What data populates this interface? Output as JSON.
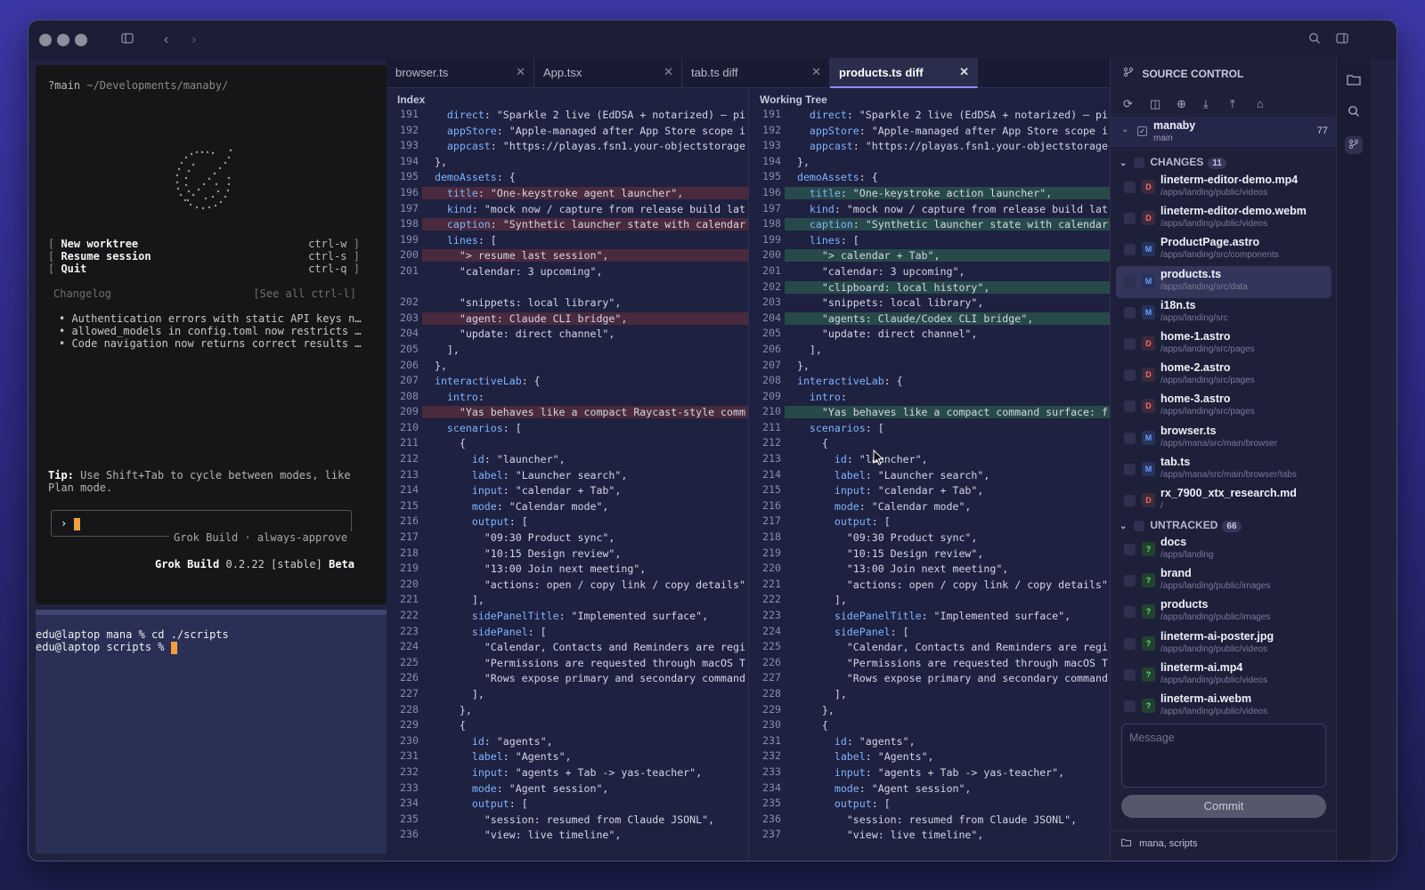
{
  "terminal": {
    "path_prefix": "?main",
    "path": "~/Developments/manaby/",
    "menu": [
      {
        "label": "New worktree",
        "key": "ctrl-w"
      },
      {
        "label": "Resume session",
        "key": "ctrl-s"
      },
      {
        "label": "Quit",
        "key": "ctrl-q"
      }
    ],
    "changelog_title": "Changelog",
    "changelog_link": "[See all ctrl-l]",
    "changelog": [
      "Authentication errors with static API keys now…",
      "allowed_models in config.toml now restricts wh…",
      "Code navigation now returns correct results fo…"
    ],
    "tip_label": "Tip:",
    "tip_text": "Use Shift+Tab to cycle between modes, like Plan mode.",
    "prompt_glyph": "›",
    "prompt_hint": "Grok Build · always-approve",
    "app_name": "Grok Build",
    "version": "0.2.22 [stable]",
    "channel": "Beta"
  },
  "shell": {
    "lines": [
      "edu@laptop mana % cd ./scripts",
      "edu@laptop scripts % "
    ]
  },
  "tabs": [
    {
      "label": "browser.ts",
      "active": false
    },
    {
      "label": "App.tsx",
      "active": false
    },
    {
      "label": "tab.ts diff",
      "active": false
    },
    {
      "label": "products.ts diff",
      "active": true
    }
  ],
  "diff": {
    "left_title": "Index",
    "right_title": "Working Tree",
    "left": [
      {
        "n": "191",
        "c": "    direct: \"Sparkle 2 live (EdDSA + notarized) — pi",
        "t": ""
      },
      {
        "n": "192",
        "c": "    appStore: \"Apple-managed after App Store scope i",
        "t": ""
      },
      {
        "n": "193",
        "c": "    appcast: \"https://playas.fsn1.your-objectstorage",
        "t": ""
      },
      {
        "n": "194",
        "c": "  },",
        "t": ""
      },
      {
        "n": "195",
        "c": "  demoAssets: {",
        "t": ""
      },
      {
        "n": "196",
        "c": "    title: \"One-keystroke agent launcher\",",
        "t": "del"
      },
      {
        "n": "197",
        "c": "    kind: \"mock now / capture from release build lat",
        "t": ""
      },
      {
        "n": "198",
        "c": "    caption: \"Synthetic launcher state with calendar",
        "t": "del"
      },
      {
        "n": "199",
        "c": "    lines: [",
        "t": ""
      },
      {
        "n": "200",
        "c": "      \"> resume last session\",",
        "t": "del"
      },
      {
        "n": "201",
        "c": "      \"calendar: 3 upcoming\",",
        "t": ""
      },
      {
        "n": "",
        "c": "",
        "t": "blank"
      },
      {
        "n": "202",
        "c": "      \"snippets: local library\",",
        "t": ""
      },
      {
        "n": "203",
        "c": "      \"agent: Claude CLI bridge\",",
        "t": "del"
      },
      {
        "n": "204",
        "c": "      \"update: direct channel\",",
        "t": ""
      },
      {
        "n": "205",
        "c": "    ],",
        "t": ""
      },
      {
        "n": "206",
        "c": "  },",
        "t": ""
      },
      {
        "n": "207",
        "c": "  interactiveLab: {",
        "t": ""
      },
      {
        "n": "208",
        "c": "    intro:",
        "t": ""
      },
      {
        "n": "209",
        "c": "      \"Yas behaves like a compact Raycast-style comm",
        "t": "del"
      },
      {
        "n": "210",
        "c": "    scenarios: [",
        "t": ""
      },
      {
        "n": "211",
        "c": "      {",
        "t": ""
      },
      {
        "n": "212",
        "c": "        id: \"launcher\",",
        "t": ""
      },
      {
        "n": "213",
        "c": "        label: \"Launcher search\",",
        "t": ""
      },
      {
        "n": "214",
        "c": "        input: \"calendar + Tab\",",
        "t": ""
      },
      {
        "n": "215",
        "c": "        mode: \"Calendar mode\",",
        "t": ""
      },
      {
        "n": "216",
        "c": "        output: [",
        "t": ""
      },
      {
        "n": "217",
        "c": "          \"09:30 Product sync\",",
        "t": ""
      },
      {
        "n": "218",
        "c": "          \"10:15 Design review\",",
        "t": ""
      },
      {
        "n": "219",
        "c": "          \"13:00 Join next meeting\",",
        "t": ""
      },
      {
        "n": "220",
        "c": "          \"actions: open / copy link / copy details\"",
        "t": ""
      },
      {
        "n": "221",
        "c": "        ],",
        "t": ""
      },
      {
        "n": "222",
        "c": "        sidePanelTitle: \"Implemented surface\",",
        "t": ""
      },
      {
        "n": "223",
        "c": "        sidePanel: [",
        "t": ""
      },
      {
        "n": "224",
        "c": "          \"Calendar, Contacts and Reminders are regi",
        "t": ""
      },
      {
        "n": "225",
        "c": "          \"Permissions are requested through macOS T",
        "t": ""
      },
      {
        "n": "226",
        "c": "          \"Rows expose primary and secondary command",
        "t": ""
      },
      {
        "n": "227",
        "c": "        ],",
        "t": ""
      },
      {
        "n": "228",
        "c": "      },",
        "t": ""
      },
      {
        "n": "229",
        "c": "      {",
        "t": ""
      },
      {
        "n": "230",
        "c": "        id: \"agents\",",
        "t": ""
      },
      {
        "n": "231",
        "c": "        label: \"Agents\",",
        "t": ""
      },
      {
        "n": "232",
        "c": "        input: \"agents + Tab -> yas-teacher\",",
        "t": ""
      },
      {
        "n": "233",
        "c": "        mode: \"Agent session\",",
        "t": ""
      },
      {
        "n": "234",
        "c": "        output: [",
        "t": ""
      },
      {
        "n": "235",
        "c": "          \"session: resumed from Claude JSONL\",",
        "t": ""
      },
      {
        "n": "236",
        "c": "          \"view: live timeline\",",
        "t": ""
      }
    ],
    "right": [
      {
        "n": "191",
        "c": "    direct: \"Sparkle 2 live (EdDSA + notarized) — pi",
        "t": ""
      },
      {
        "n": "192",
        "c": "    appStore: \"Apple-managed after App Store scope i",
        "t": ""
      },
      {
        "n": "193",
        "c": "    appcast: \"https://playas.fsn1.your-objectstorage",
        "t": ""
      },
      {
        "n": "194",
        "c": "  },",
        "t": ""
      },
      {
        "n": "195",
        "c": "  demoAssets: {",
        "t": ""
      },
      {
        "n": "196",
        "c": "    title: \"One-keystroke action launcher\",",
        "t": "add"
      },
      {
        "n": "197",
        "c": "    kind: \"mock now / capture from release build lat",
        "t": ""
      },
      {
        "n": "198",
        "c": "    caption: \"Synthetic launcher state with calendar",
        "t": "add"
      },
      {
        "n": "199",
        "c": "    lines: [",
        "t": ""
      },
      {
        "n": "200",
        "c": "      \"> calendar + Tab\",",
        "t": "add"
      },
      {
        "n": "201",
        "c": "      \"calendar: 3 upcoming\",",
        "t": ""
      },
      {
        "n": "202",
        "c": "      \"clipboard: local history\",",
        "t": "add"
      },
      {
        "n": "203",
        "c": "      \"snippets: local library\",",
        "t": ""
      },
      {
        "n": "204",
        "c": "      \"agents: Claude/Codex CLI bridge\",",
        "t": "add"
      },
      {
        "n": "205",
        "c": "      \"update: direct channel\",",
        "t": ""
      },
      {
        "n": "206",
        "c": "    ],",
        "t": ""
      },
      {
        "n": "207",
        "c": "  },",
        "t": ""
      },
      {
        "n": "208",
        "c": "  interactiveLab: {",
        "t": ""
      },
      {
        "n": "209",
        "c": "    intro:",
        "t": ""
      },
      {
        "n": "210",
        "c": "      \"Yas behaves like a compact command surface: f",
        "t": "add"
      },
      {
        "n": "211",
        "c": "    scenarios: [",
        "t": ""
      },
      {
        "n": "212",
        "c": "      {",
        "t": ""
      },
      {
        "n": "213",
        "c": "        id: \"launcher\",",
        "t": ""
      },
      {
        "n": "214",
        "c": "        label: \"Launcher search\",",
        "t": ""
      },
      {
        "n": "215",
        "c": "        input: \"calendar + Tab\",",
        "t": ""
      },
      {
        "n": "216",
        "c": "        mode: \"Calendar mode\",",
        "t": ""
      },
      {
        "n": "217",
        "c": "        output: [",
        "t": ""
      },
      {
        "n": "218",
        "c": "          \"09:30 Product sync\",",
        "t": ""
      },
      {
        "n": "219",
        "c": "          \"10:15 Design review\",",
        "t": ""
      },
      {
        "n": "220",
        "c": "          \"13:00 Join next meeting\",",
        "t": ""
      },
      {
        "n": "221",
        "c": "          \"actions: open / copy link / copy details\"",
        "t": ""
      },
      {
        "n": "222",
        "c": "        ],",
        "t": ""
      },
      {
        "n": "223",
        "c": "        sidePanelTitle: \"Implemented surface\",",
        "t": ""
      },
      {
        "n": "224",
        "c": "        sidePanel: [",
        "t": ""
      },
      {
        "n": "225",
        "c": "          \"Calendar, Contacts and Reminders are regi",
        "t": ""
      },
      {
        "n": "226",
        "c": "          \"Permissions are requested through macOS T",
        "t": ""
      },
      {
        "n": "227",
        "c": "          \"Rows expose primary and secondary command",
        "t": ""
      },
      {
        "n": "228",
        "c": "        ],",
        "t": ""
      },
      {
        "n": "229",
        "c": "      },",
        "t": ""
      },
      {
        "n": "230",
        "c": "      {",
        "t": ""
      },
      {
        "n": "231",
        "c": "        id: \"agents\",",
        "t": ""
      },
      {
        "n": "232",
        "c": "        label: \"Agents\",",
        "t": ""
      },
      {
        "n": "233",
        "c": "        input: \"agents + Tab -> yas-teacher\",",
        "t": ""
      },
      {
        "n": "234",
        "c": "        mode: \"Agent session\",",
        "t": ""
      },
      {
        "n": "235",
        "c": "        output: [",
        "t": ""
      },
      {
        "n": "236",
        "c": "          \"session: resumed from Claude JSONL\",",
        "t": ""
      },
      {
        "n": "237",
        "c": "          \"view: live timeline\",",
        "t": ""
      }
    ]
  },
  "source_control": {
    "title": "SOURCE CONTROL",
    "repo": {
      "name": "manaby",
      "branch": "main",
      "count": "77"
    },
    "changes_label": "CHANGES",
    "changes_count": "11",
    "changes": [
      {
        "name": "lineterm-editor-demo.mp4",
        "path": "/apps/landing/public/videos",
        "status": "D"
      },
      {
        "name": "lineterm-editor-demo.webm",
        "path": "/apps/landing/public/videos",
        "status": "D"
      },
      {
        "name": "ProductPage.astro",
        "path": "/apps/landing/src/components",
        "status": "M"
      },
      {
        "name": "products.ts",
        "path": "/apps/landing/src/data",
        "status": "M"
      },
      {
        "name": "i18n.ts",
        "path": "/apps/landing/src",
        "status": "M"
      },
      {
        "name": "home-1.astro",
        "path": "/apps/landing/src/pages",
        "status": "D"
      },
      {
        "name": "home-2.astro",
        "path": "/apps/landing/src/pages",
        "status": "D"
      },
      {
        "name": "home-3.astro",
        "path": "/apps/landing/src/pages",
        "status": "D"
      },
      {
        "name": "browser.ts",
        "path": "/apps/mana/src/main/browser",
        "status": "M"
      },
      {
        "name": "tab.ts",
        "path": "/apps/mana/src/main/browser/tabs",
        "status": "M"
      },
      {
        "name": "rx_7900_xtx_research.md",
        "path": "/",
        "status": "D"
      }
    ],
    "untracked_label": "UNTRACKED",
    "untracked_count": "66",
    "untracked": [
      {
        "name": "docs",
        "path": "/apps/landing",
        "status": "?"
      },
      {
        "name": "brand",
        "path": "/apps/landing/public/images",
        "status": "?"
      },
      {
        "name": "products",
        "path": "/apps/landing/public/images",
        "status": "?"
      },
      {
        "name": "lineterm-ai-poster.jpg",
        "path": "/apps/landing/public/videos",
        "status": "?"
      },
      {
        "name": "lineterm-ai.mp4",
        "path": "/apps/landing/public/videos",
        "status": "?"
      },
      {
        "name": "lineterm-ai.webm",
        "path": "/apps/landing/public/videos",
        "status": "?"
      }
    ],
    "message_placeholder": "Message",
    "commit_label": "Commit",
    "footer": "mana, scripts"
  },
  "colors": {
    "deleted": "#ff6a6a",
    "modified": "#6a9dff",
    "untracked": "#5ee07a",
    "accent": "#8a8dff"
  }
}
